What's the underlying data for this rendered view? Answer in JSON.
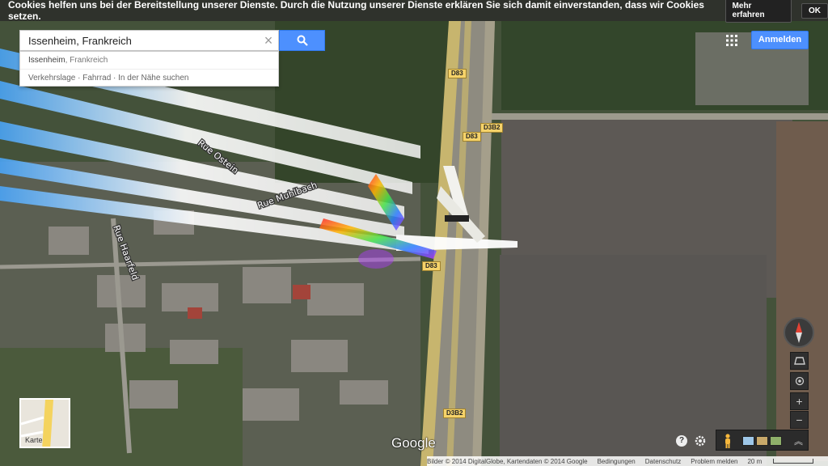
{
  "cookie_bar": {
    "text": "Cookies helfen uns bei der Bereitstellung unserer Dienste. Durch die Nutzung unserer Dienste erklären Sie sich damit einverstanden, dass wir Cookies setzen.",
    "more_label": "Mehr erfahren",
    "ok_label": "OK"
  },
  "search": {
    "value": "Issenheim, Frankreich",
    "clear_icon": "close-icon",
    "button_icon": "search-icon",
    "suggestions": [
      {
        "primary": "Issenheim",
        "secondary": ", Frankreich"
      },
      {
        "text": "Verkehrslage · Fahrrad · In der Nähe suchen"
      }
    ]
  },
  "header": {
    "apps_icon": "apps-grid-icon",
    "signin_label": "Anmelden"
  },
  "map": {
    "street_labels": [
      "Rue Ostein",
      "Rue Muhlbach",
      "Rue Haarfeld"
    ],
    "route_shields": [
      "D83",
      "D3B2",
      "D83",
      "D83",
      "D3B2"
    ]
  },
  "controls": {
    "compass_icon": "compass-icon",
    "tilt_icon": "tilt-icon",
    "location_icon": "my-location-icon",
    "zoom_in_label": "+",
    "zoom_out_label": "−"
  },
  "minimap": {
    "label": "Karte"
  },
  "branding": {
    "logo": "Google"
  },
  "bottom_controls": {
    "help_label": "?",
    "settings_icon": "gear-icon",
    "pegman_icon": "pegman-icon",
    "expand_label": "︽"
  },
  "footer": {
    "attribution": "Bilder © 2014 DigitalGlobe, Kartendaten © 2014 Google",
    "terms": "Bedingungen",
    "privacy": "Datenschutz",
    "report": "Problem melden",
    "scale": "20 m"
  },
  "colors": {
    "accent": "#4d90fe",
    "field": "#5a5650",
    "vegetation": "#3c4a2e",
    "road": "#c9b870"
  }
}
